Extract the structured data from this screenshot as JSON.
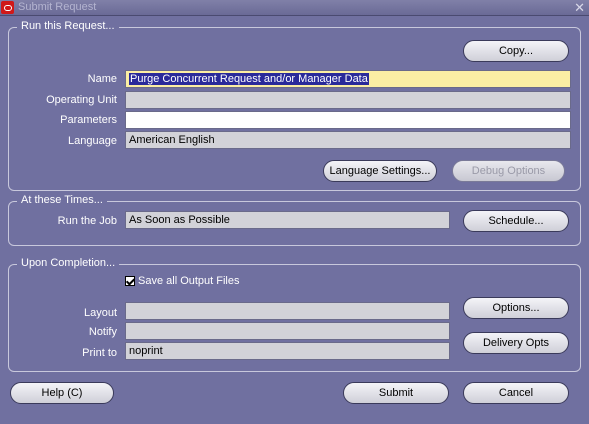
{
  "window": {
    "title": "Submit Request"
  },
  "run_request": {
    "legend": "Run this Request...",
    "copy_label": "Copy...",
    "name_label": "Name",
    "name_value": "Purge Concurrent Request and/or Manager Data",
    "operating_unit_label": "Operating Unit",
    "operating_unit_value": "",
    "parameters_label": "Parameters",
    "parameters_value": "",
    "language_label": "Language",
    "language_value": "American English",
    "language_settings_label": "Language Settings...",
    "debug_options_label": "Debug Options"
  },
  "schedule": {
    "legend": "At these Times...",
    "run_job_label": "Run the Job",
    "run_job_value": "As Soon as Possible",
    "schedule_label": "Schedule..."
  },
  "completion": {
    "legend": "Upon Completion...",
    "save_output_label": "Save all Output Files",
    "save_output_checked": true,
    "layout_label": "Layout",
    "layout_value": "",
    "notify_label": "Notify",
    "notify_value": "",
    "print_to_label": "Print to",
    "print_to_value": "noprint",
    "options_label": "Options...",
    "delivery_opts_label": "Delivery Opts"
  },
  "footer": {
    "help_label": "Help (C)",
    "submit_label": "Submit",
    "cancel_label": "Cancel"
  }
}
